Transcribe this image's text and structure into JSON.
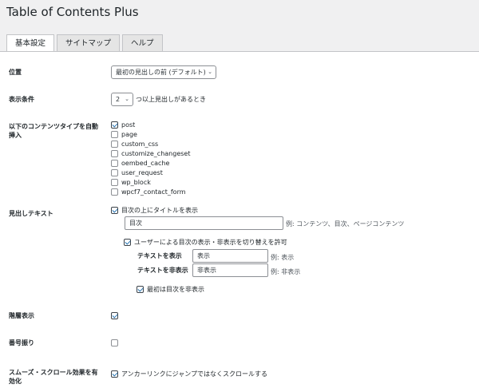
{
  "page_title": "Table of Contents Plus",
  "tabs": [
    "基本設定",
    "サイトマップ",
    "ヘルプ"
  ],
  "position": {
    "label": "位置",
    "selected": "最初の見出しの前 (デフォルト)"
  },
  "display_condition": {
    "label": "表示条件",
    "count": "2",
    "suffix": "つ以上見出しがあるとき"
  },
  "auto_insert": {
    "label_line1": "以下のコンテンツタイプを自動",
    "label_line2": "挿入",
    "items": [
      {
        "label": "post",
        "checked": true
      },
      {
        "label": "page",
        "checked": false
      },
      {
        "label": "custom_css",
        "checked": false
      },
      {
        "label": "customize_changeset",
        "checked": false
      },
      {
        "label": "oembed_cache",
        "checked": false
      },
      {
        "label": "user_request",
        "checked": false
      },
      {
        "label": "wp_block",
        "checked": false
      },
      {
        "label": "wpcf7_contact_form",
        "checked": false
      }
    ]
  },
  "heading_text": {
    "label": "見出しテキスト",
    "show_title_label": "目次の上にタイトルを表示",
    "title_value": "目次",
    "title_hint": "例: コンテンツ、目次、ページコンテンツ",
    "allow_toggle_label": "ユーザーによる目次の表示・非表示を切り替えを許可",
    "show_label": "テキストを表示",
    "show_value": "表示",
    "show_hint": "例: 表示",
    "hide_label": "テキストを非表示",
    "hide_value": "非表示",
    "hide_hint": "例: 非表示",
    "initially_hidden_label": "最初は目次を非表示"
  },
  "hierarchy": {
    "label": "階層表示",
    "checked": true
  },
  "numbering": {
    "label": "番号振り",
    "checked": false
  },
  "smooth_scroll": {
    "label_line1": "スムーズ・スクロール効果を有",
    "label_line2": "効化",
    "checkbox_label": "アンカーリンクにジャンプではなくスクロールする",
    "checked": true
  },
  "icons": {
    "select_chevron": "chevron-down-icon",
    "checkmark": "check-icon"
  }
}
